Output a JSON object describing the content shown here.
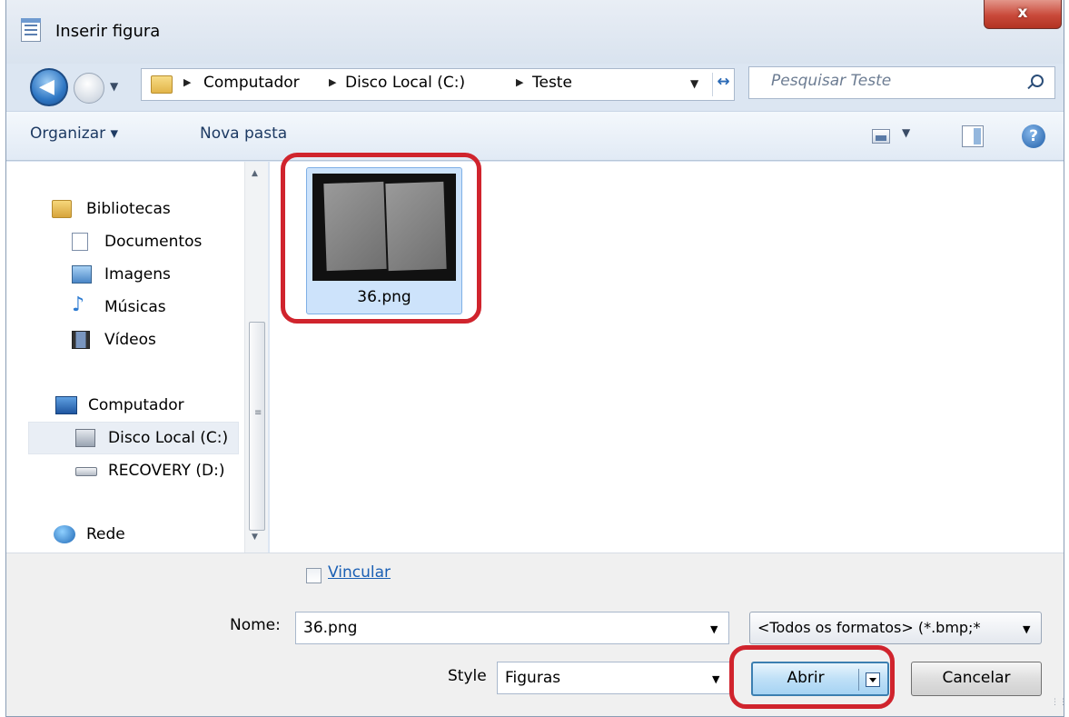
{
  "window": {
    "title": "Inserir figura",
    "close": "x"
  },
  "nav": {
    "back": "◀",
    "breadcrumb": [
      "Computador",
      "Disco Local (C:)",
      "Teste"
    ],
    "search_placeholder": "Pesquisar Teste",
    "refresh": "↔"
  },
  "toolbar": {
    "organize": "Organizar ▾",
    "new_folder": "Nova pasta",
    "help": "?"
  },
  "sidebar": {
    "groups": [
      {
        "label": "Bibliotecas",
        "icon": "libraries-icon",
        "items": [
          {
            "label": "Documentos",
            "icon": "documents-icon"
          },
          {
            "label": "Imagens",
            "icon": "pictures-icon"
          },
          {
            "label": "Músicas",
            "icon": "music-icon"
          },
          {
            "label": "Vídeos",
            "icon": "videos-icon"
          }
        ]
      },
      {
        "label": "Computador",
        "icon": "computer-icon",
        "items": [
          {
            "label": "Disco Local (C:)",
            "icon": "local-disk-icon",
            "selected": true
          },
          {
            "label": "RECOVERY (D:)",
            "icon": "drive-icon"
          }
        ]
      },
      {
        "label": "Rede",
        "icon": "network-icon",
        "items": []
      }
    ]
  },
  "files": [
    {
      "name": "36.png",
      "selected": true
    }
  ],
  "link": {
    "label": "Vincular",
    "checked": false
  },
  "filename": {
    "label": "Nome:",
    "value": "36.png"
  },
  "filter": {
    "value": "<Todos os formatos> (*.bmp;*"
  },
  "style": {
    "label": "Style",
    "value": "Figuras"
  },
  "buttons": {
    "open": "Abrir",
    "cancel": "Cancelar"
  },
  "colors": {
    "highlight": "#d0242d",
    "accent": "#1a5fb4",
    "selection": "#cde3fb"
  }
}
